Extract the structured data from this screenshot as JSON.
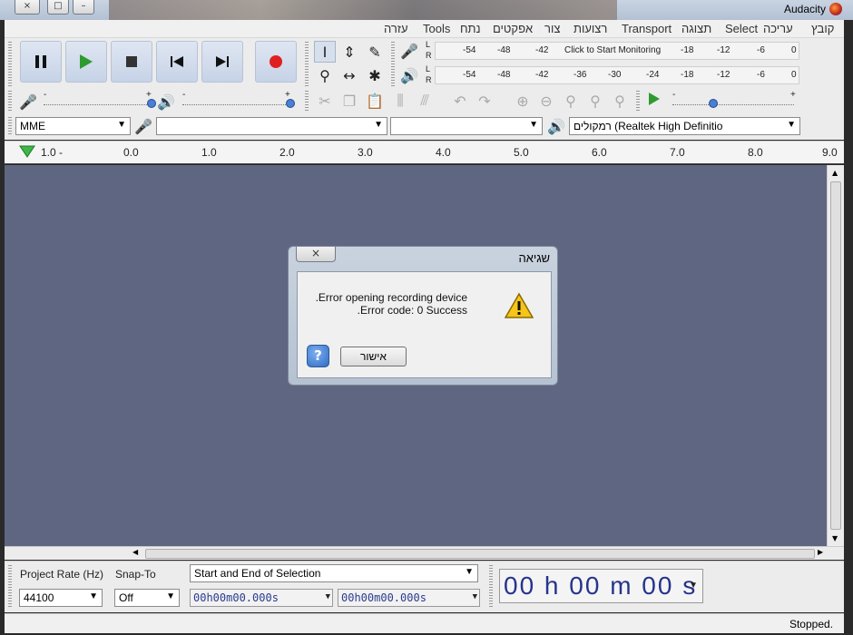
{
  "window": {
    "title": "Audacity",
    "controls": [
      "×",
      "□",
      "–"
    ]
  },
  "menu": [
    "קובץ",
    "עריכה",
    "Select",
    "תצוגה",
    "Transport",
    "רצועות",
    "צור",
    "אפקטים",
    "נתח",
    "Tools",
    "עזרה"
  ],
  "transport": {
    "pause": "pause-icon",
    "play": "play-icon",
    "stop": "stop-icon",
    "skip_start": "skip-start-icon",
    "skip_end": "skip-end-icon",
    "record": "record-icon",
    "record_color": "#e02020"
  },
  "meters": {
    "record": {
      "ticks": [
        "-54",
        "-48",
        "-42",
        "-18",
        "-12",
        "-6",
        "0"
      ],
      "prompt": "Click to Start Monitoring"
    },
    "playback": {
      "ticks": [
        "-54",
        "-48",
        "-42",
        "-36",
        "-30",
        "-24",
        "-18",
        "-12",
        "-6",
        "0"
      ]
    },
    "channel_l": "L",
    "channel_r": "R"
  },
  "mixer": {
    "minus": "-",
    "plus": "+"
  },
  "device": {
    "host": "MME",
    "recording_device": "",
    "recording_channels": "",
    "playback_device": "רמקולים (Realtek High Definitio"
  },
  "ruler": {
    "ticks": [
      "1.0 -",
      "0.0",
      "1.0",
      "2.0",
      "3.0",
      "4.0",
      "5.0",
      "6.0",
      "7.0",
      "8.0",
      "9.0"
    ]
  },
  "dialog": {
    "title": "שגיאה",
    "close": "×",
    "message_line1": ".Error opening recording device",
    "message_line2": ".Error code: 0 Success",
    "ok_label": "אישור",
    "help_label": "?",
    "icon": "warning-icon"
  },
  "selection_toolbar": {
    "project_rate_label": "Project Rate (Hz)",
    "project_rate_value": "44100",
    "snap_to_label": "Snap-To",
    "snap_to_value": "Off",
    "selection_mode": "Start and End of Selection",
    "start_time": "00h00m00.000s",
    "end_time": "00h00m00.000s",
    "audio_position": "00 h 00 m 00 s"
  },
  "status": {
    "text": "Stopped."
  }
}
